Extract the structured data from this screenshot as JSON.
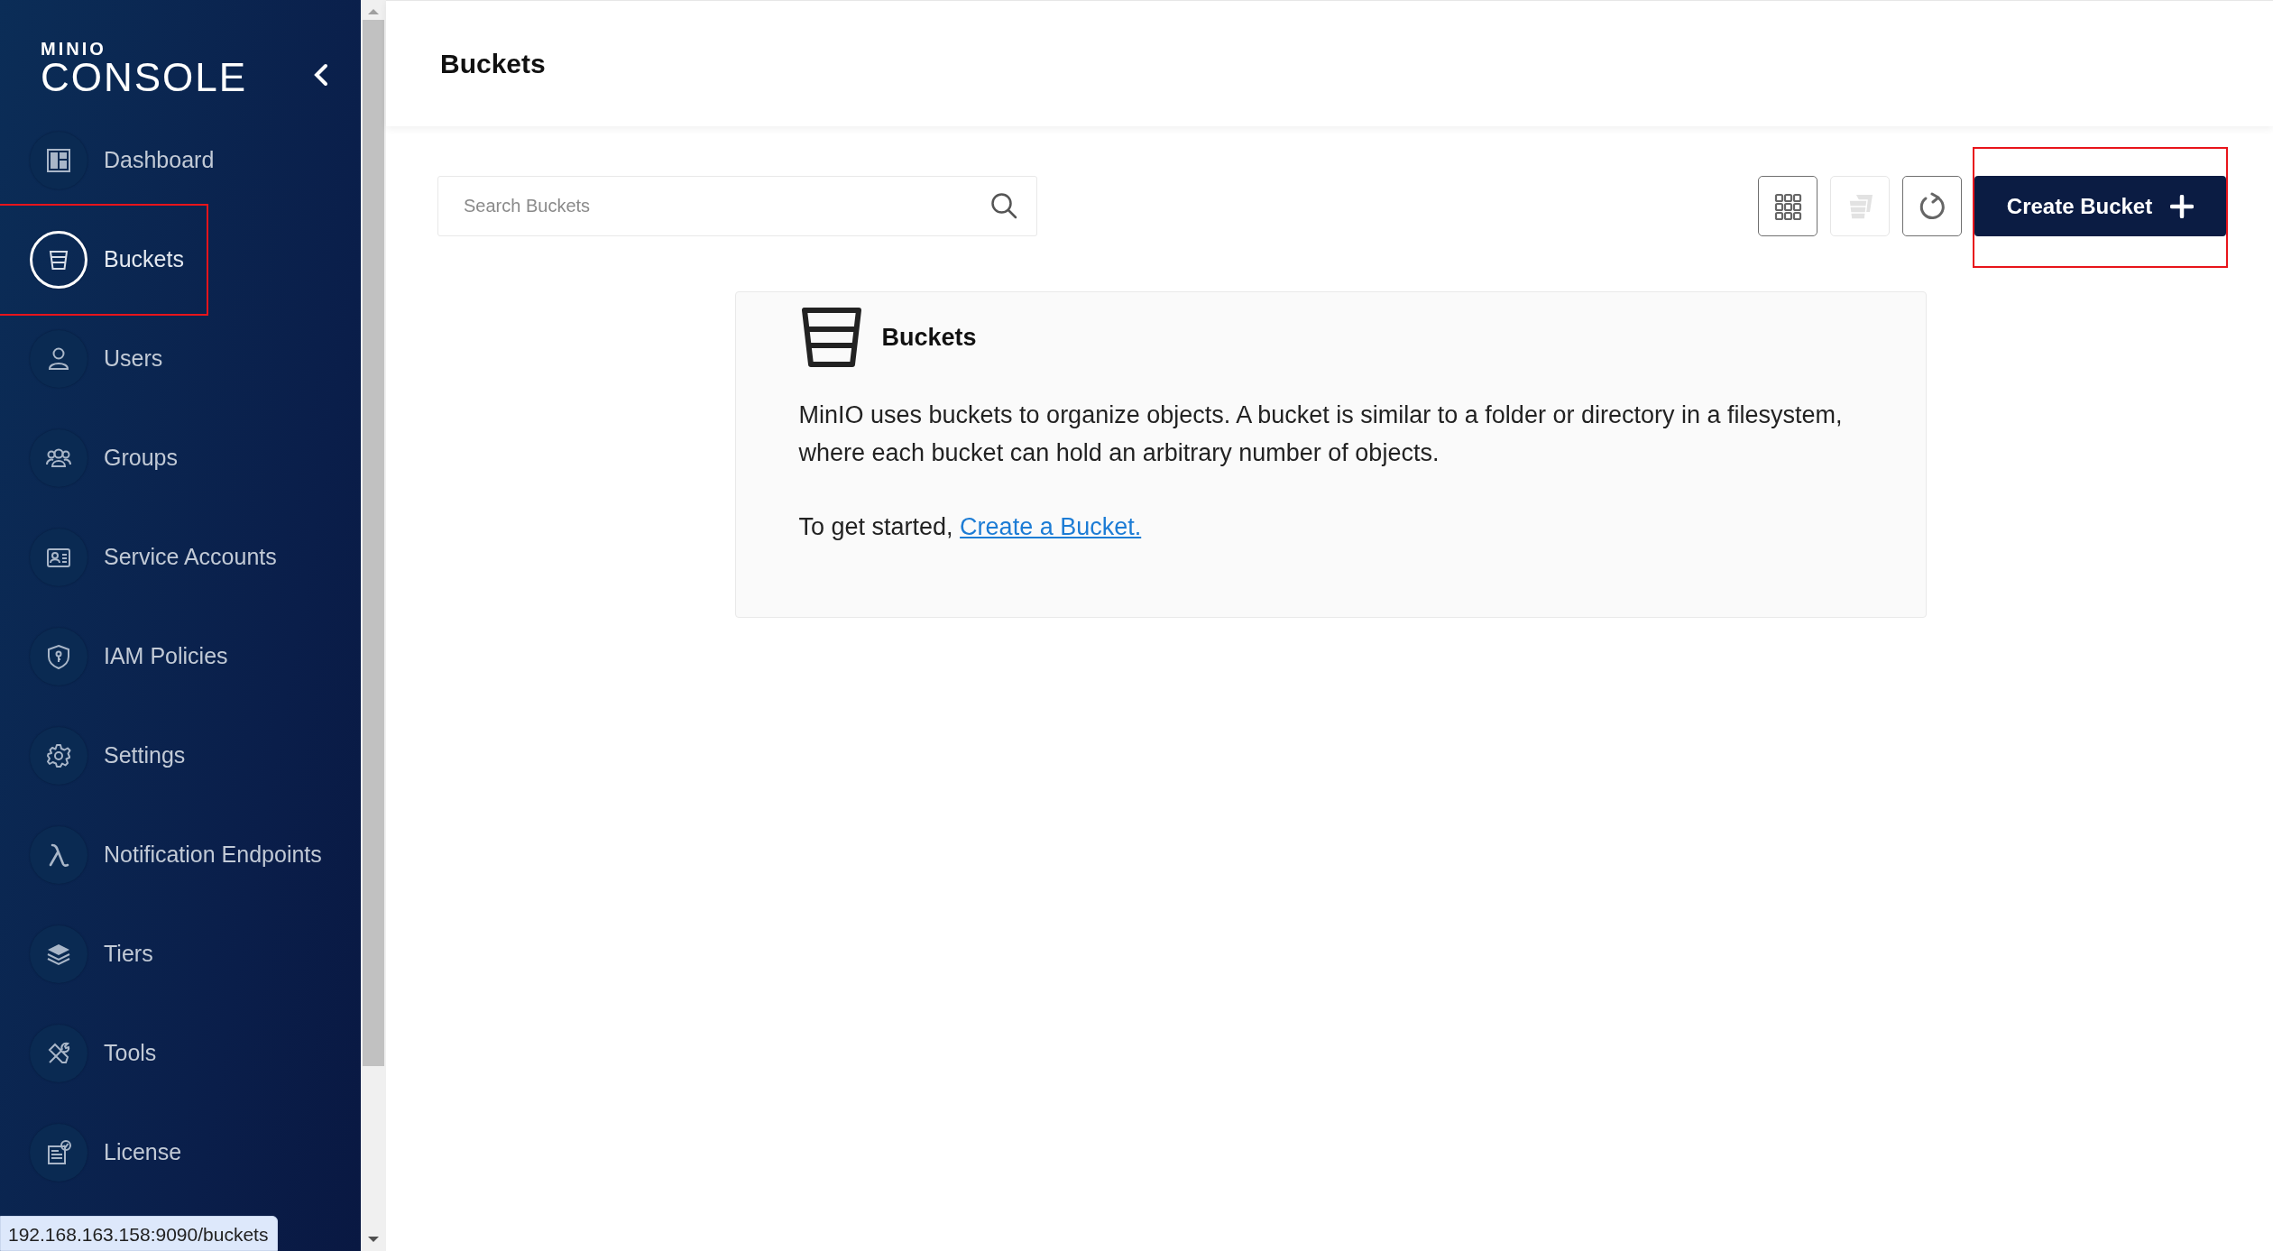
{
  "sidebar": {
    "logo": {
      "brand": "MINIO",
      "product": "CONSOLE"
    },
    "items": [
      {
        "label": "Dashboard",
        "selected": false,
        "highlighted": false
      },
      {
        "label": "Buckets",
        "selected": true,
        "highlighted": true
      },
      {
        "label": "Users",
        "selected": false,
        "highlighted": false
      },
      {
        "label": "Groups",
        "selected": false,
        "highlighted": false
      },
      {
        "label": "Service Accounts",
        "selected": false,
        "highlighted": false
      },
      {
        "label": "IAM Policies",
        "selected": false,
        "highlighted": false
      },
      {
        "label": "Settings",
        "selected": false,
        "highlighted": false
      },
      {
        "label": "Notification Endpoints",
        "selected": false,
        "highlighted": false
      },
      {
        "label": "Tiers",
        "selected": false,
        "highlighted": false
      },
      {
        "label": "Tools",
        "selected": false,
        "highlighted": false
      },
      {
        "label": "License",
        "selected": false,
        "highlighted": false
      }
    ]
  },
  "header": {
    "title": "Buckets"
  },
  "toolbar": {
    "search": {
      "placeholder": "Search Buckets"
    },
    "buttons": [
      {
        "kind": "grid",
        "disabled": false
      },
      {
        "kind": "multi-bucket",
        "disabled": true
      },
      {
        "kind": "refresh",
        "disabled": false
      }
    ],
    "create_button": {
      "label": "Create Bucket",
      "highlighted": true
    }
  },
  "empty_state": {
    "title": "Buckets",
    "description": "MinIO uses buckets to organize objects. A bucket is similar to a folder or directory in a filesystem, where each bucket can hold an arbitrary number of objects.",
    "prompt": "To get started,",
    "link": "Create a Bucket."
  },
  "status_url": "192.168.163.158:9090/buckets"
}
